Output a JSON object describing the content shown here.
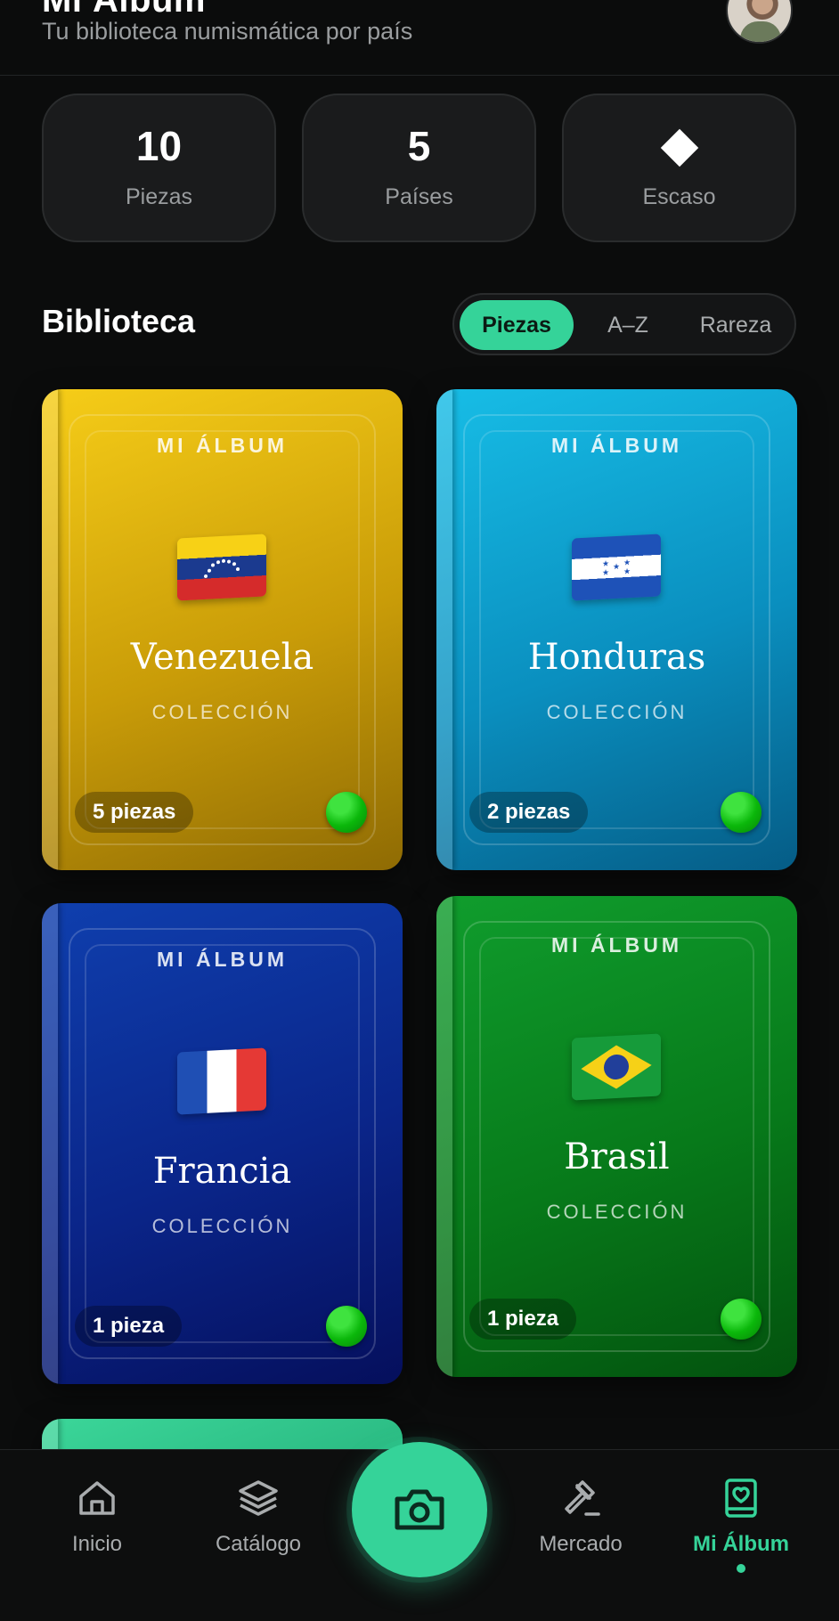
{
  "header": {
    "title": "Mi Álbum",
    "subtitle": "Tu biblioteca numismática por país"
  },
  "stats": [
    {
      "value": "10",
      "label": "Piezas"
    },
    {
      "value": "5",
      "label": "Países"
    },
    {
      "value": "",
      "label": "Escaso",
      "icon": "diamond-icon"
    }
  ],
  "library": {
    "title": "Biblioteca",
    "sort_options": [
      "Piezas",
      "A–Z",
      "Rareza"
    ],
    "selected_sort": "Piezas"
  },
  "albums": [
    {
      "kicker": "MI ÁLBUM",
      "country": "Venezuela",
      "subtitle": "COLECCIÓN",
      "count_label": "5 piezas",
      "color": "#e0b510",
      "flag": "venezuela-flag-icon"
    },
    {
      "kicker": "MI ÁLBUM",
      "country": "Honduras",
      "subtitle": "COLECCIÓN",
      "count_label": "2 piezas",
      "color": "#0ea5d8",
      "flag": "honduras-flag-icon"
    },
    {
      "kicker": "MI ÁLBUM",
      "country": "Francia",
      "subtitle": "COLECCIÓN",
      "count_label": "1 pieza",
      "color": "#0a2a92",
      "flag": "france-flag-icon"
    },
    {
      "kicker": "MI ÁLBUM",
      "country": "Brasil",
      "subtitle": "COLECCIÓN",
      "count_label": "1 pieza",
      "color": "#0b8a24",
      "flag": "brazil-flag-icon"
    }
  ],
  "nav": {
    "items": [
      {
        "label": "Inicio",
        "icon": "home-icon"
      },
      {
        "label": "Catálogo",
        "icon": "layers-icon"
      },
      {
        "label": "Mercado",
        "icon": "gavel-icon"
      },
      {
        "label": "Mi Álbum",
        "icon": "album-heart-icon",
        "active": true
      }
    ],
    "fab_icon": "camera-icon"
  },
  "colors": {
    "accent": "#35d399",
    "background": "#0b0c0c",
    "status_dot": "#12c012"
  }
}
